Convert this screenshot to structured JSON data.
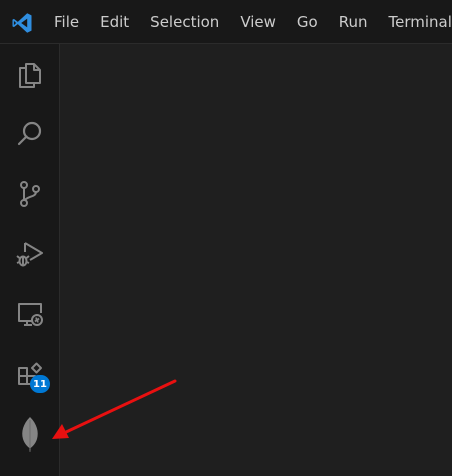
{
  "titlebar": {
    "logo_icon": "vscode-logo-icon",
    "menu": [
      {
        "label": "File"
      },
      {
        "label": "Edit"
      },
      {
        "label": "Selection"
      },
      {
        "label": "View"
      },
      {
        "label": "Go"
      },
      {
        "label": "Run"
      },
      {
        "label": "Terminal"
      }
    ]
  },
  "activitybar": {
    "items": [
      {
        "icon": "files-icon"
      },
      {
        "icon": "search-icon"
      },
      {
        "icon": "source-control-icon"
      },
      {
        "icon": "run-debug-icon"
      },
      {
        "icon": "remote-explorer-icon"
      },
      {
        "icon": "extensions-icon",
        "badge": "11"
      },
      {
        "icon": "mongodb-leaf-icon"
      }
    ]
  },
  "annotation": {
    "icon": "red-arrow-icon",
    "color": "#e81010"
  },
  "colors": {
    "accent": "#0078d4",
    "background": "#1f1f1f",
    "bar": "#181818",
    "icon": "#858585"
  }
}
